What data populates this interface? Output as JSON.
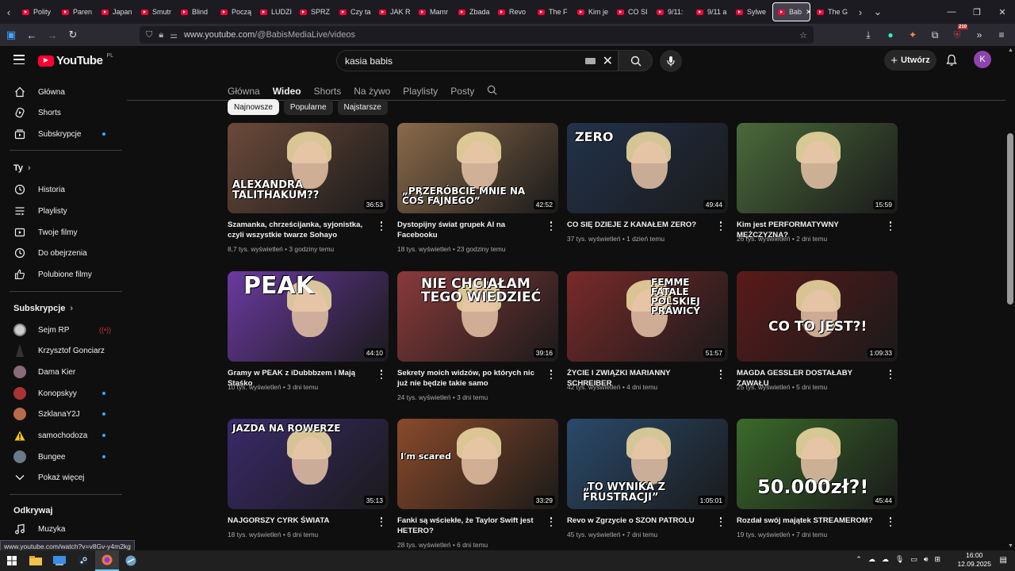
{
  "browser": {
    "tabs": [
      "Polity",
      "Paren",
      "Japan",
      "Smutr",
      "Blind",
      "Począ",
      "LUDZI",
      "SPRZ",
      "Czy ta",
      "JAK R",
      "Mamr",
      "Zbada",
      "Revo",
      "The F",
      "Kim je",
      "CO SI",
      "9/11:",
      "9/11 a",
      "Sylwe",
      "Bab",
      "The G"
    ],
    "active_tab_index": 19,
    "url_base": "www.youtube.com",
    "url_path": "/@BabisMediaLive/videos",
    "badge_count": "210"
  },
  "header": {
    "logo_text": "YouTube",
    "region": "PL",
    "search_value": "kasia babis",
    "create_label": "Utwórz",
    "avatar_letter": "K"
  },
  "sidebar": {
    "main": [
      "Główna",
      "Shorts",
      "Subskrypcje"
    ],
    "you_header": "Ty",
    "you_items": [
      "Historia",
      "Playlisty",
      "Twoje filmy",
      "Do obejrzenia",
      "Polubione filmy"
    ],
    "subs_header": "Subskrypcje",
    "subs": [
      {
        "name": "Sejm RP",
        "dot": false,
        "live": true
      },
      {
        "name": "Krzysztof Gonciarz",
        "dot": false,
        "live": false
      },
      {
        "name": "Dama Kier",
        "dot": false,
        "live": false
      },
      {
        "name": "Konopskyy",
        "dot": true,
        "live": false
      },
      {
        "name": "SzklanaY2J",
        "dot": true,
        "live": false
      },
      {
        "name": "samochodoza",
        "dot": true,
        "live": false
      },
      {
        "name": "Bungee",
        "dot": true,
        "live": false
      }
    ],
    "show_more": "Pokaż więcej",
    "explore_header": "Odkrywaj",
    "explore_items": [
      "Muzyka"
    ]
  },
  "channel_tabs": [
    "Główna",
    "Wideo",
    "Shorts",
    "Na żywo",
    "Playlisty",
    "Posty"
  ],
  "active_channel_tab": "Wideo",
  "chips": [
    "Najnowsze",
    "Popularne",
    "Najstarsze"
  ],
  "active_chip": "Najnowsze",
  "videos": [
    {
      "title": "Szamanka, chrześcijanka, syjonistka, czyli wszystkie twarze Sohayo",
      "views": "8,7 tys. wyświetleń",
      "age": "3 godziny temu",
      "duration": "36:53",
      "thumb_text": "ALEXANDRA TALITHAKUM??",
      "bg": "#6b4a3a"
    },
    {
      "title": "Dystopijny świat grupek AI na Facebooku",
      "views": "18 tys. wyświetleń",
      "age": "23 godziny temu",
      "duration": "42:52",
      "thumb_text": "„PRZERÓBCIE MNIE NA COŚ FAJNEGO”",
      "bg": "#8a6a4a"
    },
    {
      "title": "CO SIĘ DZIEJE Z KANAŁEM ZERO?",
      "views": "37 tys. wyświetleń",
      "age": "1 dzień temu",
      "duration": "49:44",
      "thumb_text": "ZERO",
      "bg": "#22324a"
    },
    {
      "title": "Kim jest PERFORMATYWNY MĘŻCZYZNA?",
      "views": "26 tys. wyświetleń",
      "age": "2 dni temu",
      "duration": "15:59",
      "thumb_text": "",
      "bg": "#4a6a3a"
    },
    {
      "title": "Gramy w PEAK z iDubbbzem i Mają Staśko",
      "views": "10 tys. wyświetleń",
      "age": "3 dni temu",
      "duration": "44:10",
      "thumb_text": "PEAK",
      "bg": "#6a3aa0"
    },
    {
      "title": "Sekrety moich widzów, po których nic już nie będzie takie samo",
      "views": "24 tys. wyświetleń",
      "age": "3 dni temu",
      "duration": "39:16",
      "thumb_text": "NIE CHCIAŁAM TEGO WIEDZIEĆ",
      "bg": "#8a3a3a"
    },
    {
      "title": "ŻYCIE I ZWIĄZKI MARIANNY SCHREIBER",
      "views": "42 tys. wyświetleń",
      "age": "4 dni temu",
      "duration": "51:57",
      "thumb_text": "FEMME FATALE POLSKIEJ PRAWICY",
      "bg": "#7a2a2a"
    },
    {
      "title": "MAGDA GESSLER DOSTAŁABY ZAWAŁU",
      "views": "25 tys. wyświetleń",
      "age": "5 dni temu",
      "duration": "1:09:33",
      "thumb_text": "CO TO JEST?!",
      "bg": "#5a1a1a"
    },
    {
      "title": "NAJGORSZY CYRK ŚWIATA",
      "views": "18 tys. wyświetleń",
      "age": "6 dni temu",
      "duration": "35:13",
      "thumb_text": "JAZDA NA ROWERZE",
      "bg": "#3a2a6a"
    },
    {
      "title": "Fanki są wściekłe, że Taylor Swift jest HETERO?",
      "views": "28 tys. wyświetleń",
      "age": "6 dni temu",
      "duration": "33:29",
      "thumb_text": "I'm scared",
      "bg": "#8a4a2a"
    },
    {
      "title": "Revo w Zgrzycie o SZON PATROLU",
      "views": "45 tys. wyświetleń",
      "age": "7 dni temu",
      "duration": "1:05:01",
      "thumb_text": "„TO WYNIKA Z FRUSTRACJI”",
      "bg": "#2a4a6a"
    },
    {
      "title": "Rozdał swój majątek STREAMEROM?",
      "views": "19 tys. wyświetleń",
      "age": "7 dni temu",
      "duration": "45:44",
      "thumb_text": "50.000zł?!",
      "bg": "#3a6a2a"
    }
  ],
  "status_url": "www.youtube.com/watch?v=v8Gv-y4m2kg",
  "clock": {
    "time": "16:00",
    "date": "12.09.2025"
  }
}
